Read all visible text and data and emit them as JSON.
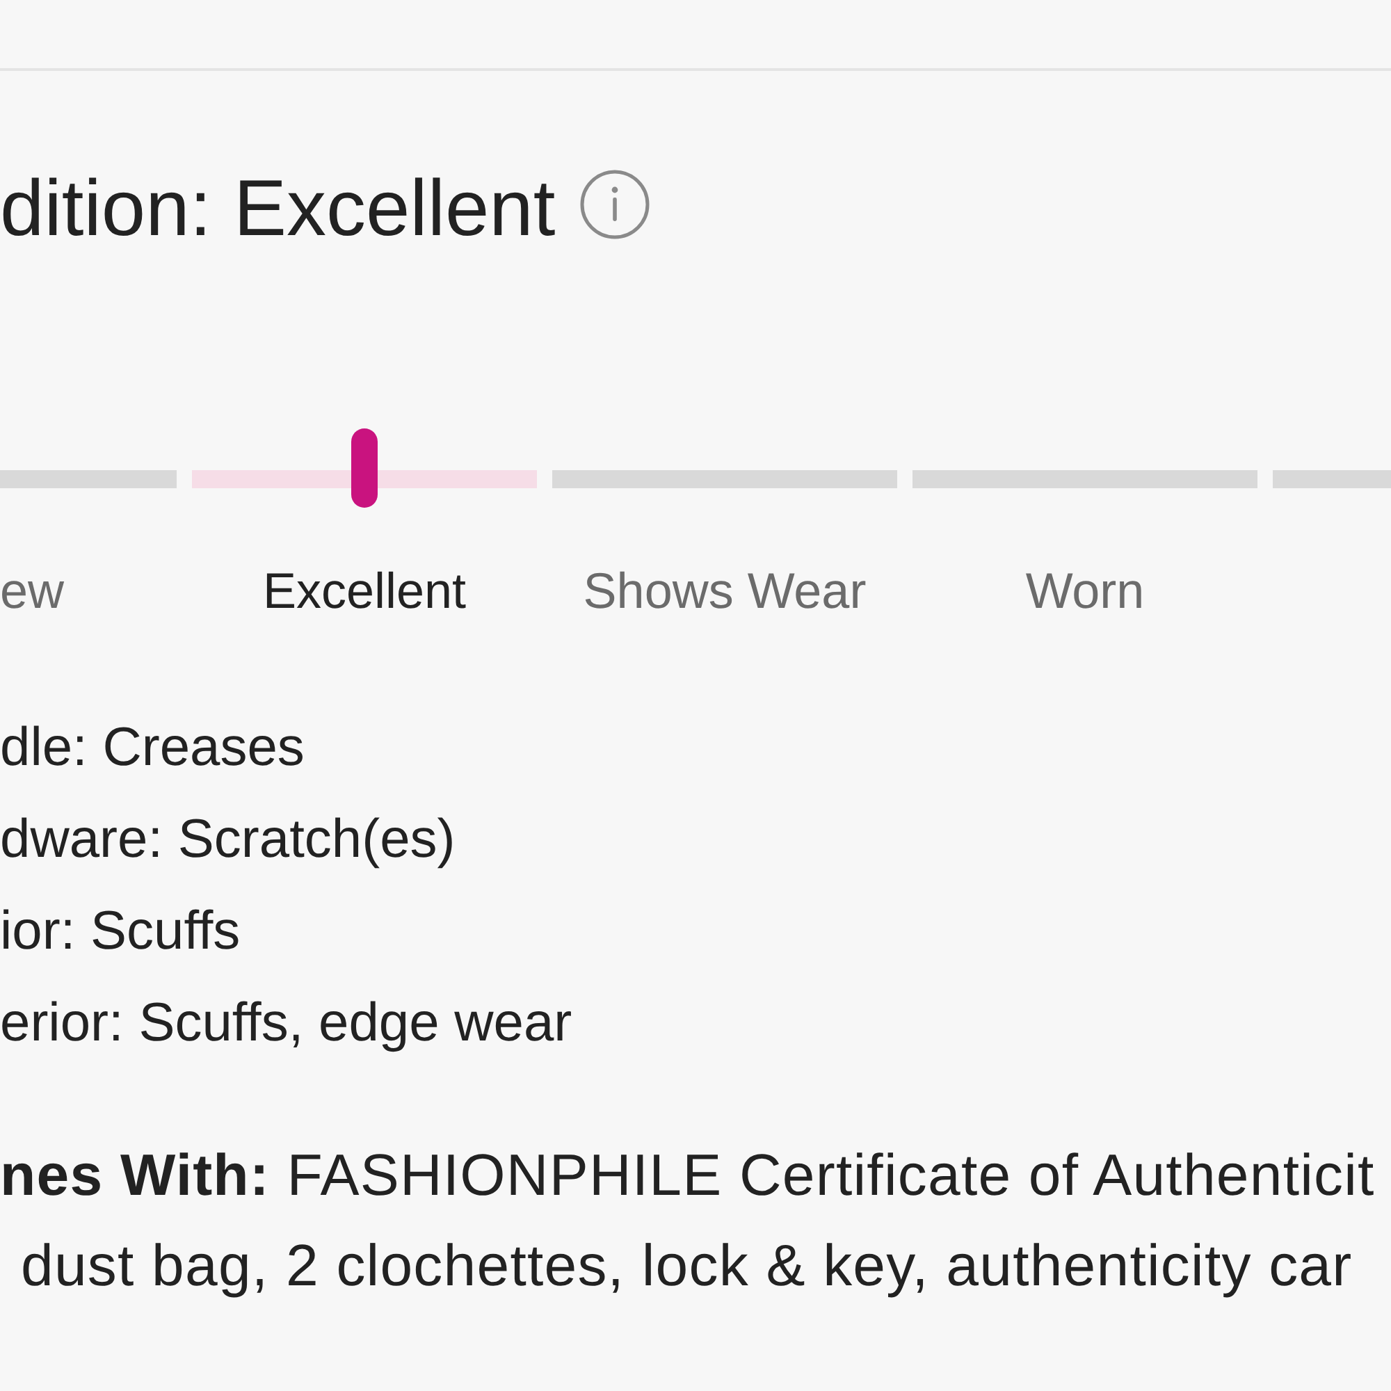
{
  "condition": {
    "heading": "dition: Excellent"
  },
  "scale": {
    "segments": [
      {
        "label": "ew",
        "selected": false
      },
      {
        "label": "Excellent",
        "selected": true
      },
      {
        "label": "Shows Wear",
        "selected": false
      },
      {
        "label": "Worn",
        "selected": false
      },
      {
        "selected": false
      }
    ]
  },
  "details": [
    "dle: Creases",
    "dware: Scratch(es)",
    "ior: Scuffs",
    "erior: Scuffs, edge wear"
  ],
  "comes_with": [
    "**nes With:** FASHIONPHILE Certificate of Authenticit",
    "dust bag, 2 clochettes, lock & key, authenticity car"
  ]
}
